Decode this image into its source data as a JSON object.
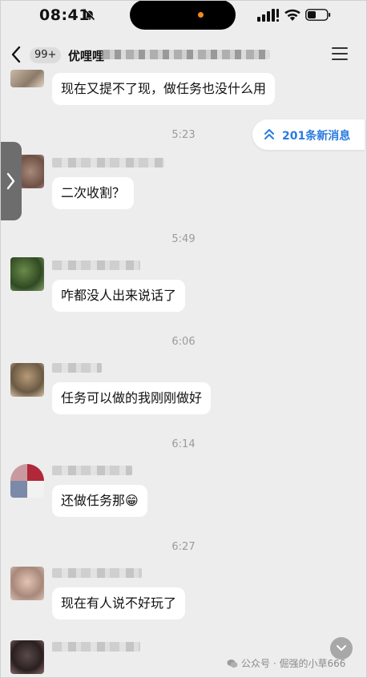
{
  "status_bar": {
    "time": "08:41"
  },
  "nav": {
    "unread_badge": "99+",
    "title": "优哩哩"
  },
  "new_messages_pill": {
    "label": "201条新消息"
  },
  "messages": [
    {
      "text": "现在又提不了现，做任务也没什么用"
    },
    {
      "time": "5:23"
    },
    {
      "text": "二次收割？"
    },
    {
      "time": "5:49"
    },
    {
      "text": "咋都没人出来说话了"
    },
    {
      "time": "6:06"
    },
    {
      "text": "任务可以做的我刚刚做好"
    },
    {
      "time": "6:14"
    },
    {
      "text": "还做任务那😁"
    },
    {
      "time": "6:27"
    },
    {
      "text": "现在有人说不好玩了"
    }
  ],
  "watermark": {
    "text": "公众号 · 倔强的小草666"
  },
  "icons": [
    "bell-muted-icon",
    "signal-icon",
    "wifi-icon",
    "battery-icon",
    "back-chevron-icon",
    "menu-icon",
    "double-chevron-up-icon",
    "side-chevron-icon",
    "scroll-down-icon",
    "wechat-icon"
  ]
}
